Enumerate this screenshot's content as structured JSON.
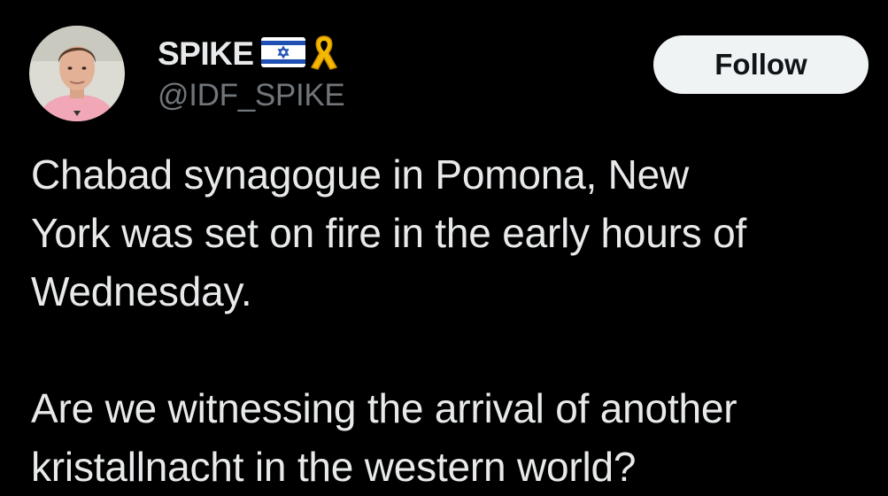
{
  "author": {
    "display_name": "SPIKE",
    "handle": "@IDF_SPIKE",
    "badges": [
      "israel-flag-icon",
      "yellow-ribbon-icon"
    ]
  },
  "follow_button": {
    "label": "Follow"
  },
  "tweet": {
    "paragraph_1": "Chabad synagogue in Pomona, New\nYork was set on fire in the early hours of\nWednesday.",
    "paragraph_2": "Are we witnessing the arrival of another\nkristallnacht in the western world?"
  },
  "colors": {
    "background": "#000000",
    "text_primary": "#e7e9ea",
    "text_secondary": "#71767b",
    "button_bg": "#eff3f4",
    "button_text": "#0f1419",
    "flag_blue": "#1f4fb3",
    "ribbon_yellow": "#f5b800"
  }
}
